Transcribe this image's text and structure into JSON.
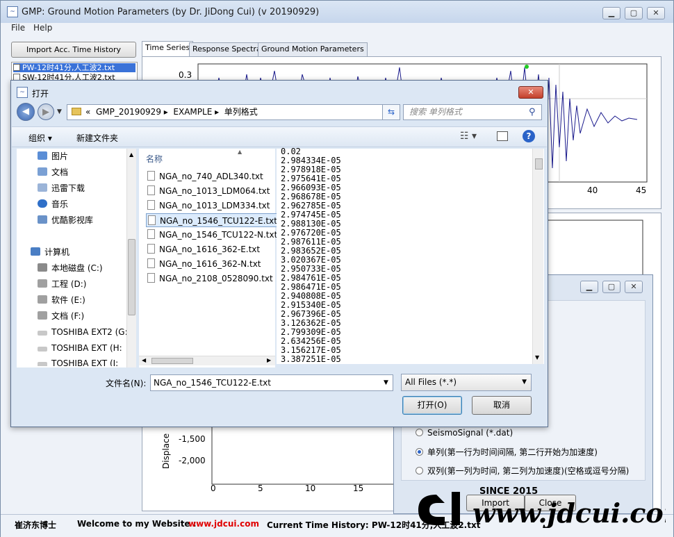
{
  "main": {
    "title": "GMP: Ground Motion Parameters (by Dr. JiDong Cui) (v 20190929)",
    "menu": [
      "File",
      "Help"
    ],
    "import_button": "Import Acc. Time History",
    "files": [
      "PW-12时41分,人工波2.txt",
      "SW-12时41分,人工波2.txt"
    ],
    "tabs": [
      "Time Series",
      "Response Spectra",
      "Ground Motion Parameters"
    ],
    "plot_top": {
      "ytick": "0.3",
      "xticks": [
        "40",
        "45"
      ]
    },
    "plot_bottom": {
      "ylabel": "Displace",
      "yticks": [
        "-1,500",
        "-2,000"
      ],
      "xticks": [
        "0",
        "5",
        "10",
        "15"
      ]
    }
  },
  "status": {
    "author": "崔济东博士",
    "welcome": "Welcome to my Website :",
    "url": "www.jdcui.com",
    "current": "Current Time History: PW-12时41分,人工波2.txt"
  },
  "dialog": {
    "title": "打开",
    "breadcrumb": [
      "GMP_20190929",
      "EXAMPLE",
      "单列格式"
    ],
    "search_placeholder": "搜索 单列格式",
    "toolbar": {
      "organize": "组织 ▾",
      "new_folder": "新建文件夹"
    },
    "nav_items": [
      "图片",
      "文档",
      "迅雷下载",
      "音乐",
      "优酷影视库",
      "计算机",
      "本地磁盘 (C:)",
      "工程 (D:)",
      "软件 (E:)",
      "文档 (F:)",
      "TOSHIBA EXT2 (G:",
      "TOSHIBA EXT (H:",
      "TOSHIBA EXT (I:"
    ],
    "column_header": "名称",
    "files": [
      "NGA_no_740_ADL340.txt",
      "NGA_no_1013_LDM064.txt",
      "NGA_no_1013_LDM334.txt",
      "NGA_no_1546_TCU122-E.txt",
      "NGA_no_1546_TCU122-N.txt",
      "NGA_no_1616_362-E.txt",
      "NGA_no_1616_362-N.txt",
      "NGA_no_2108_0528090.txt"
    ],
    "selected_index": 3,
    "preview_lines": [
      "0.02",
      "2.984334E-05",
      "2.978918E-05",
      "2.975641E-05",
      "2.966093E-05",
      "2.968678E-05",
      "2.962785E-05",
      "2.974745E-05",
      "2.988130E-05",
      "2.976720E-05",
      "2.987611E-05",
      "2.983652E-05",
      "3.020367E-05",
      "2.950733E-05",
      "2.984761E-05",
      "2.986471E-05",
      "2.940808E-05",
      "2.915340E-05",
      "2.967396E-05",
      "3.126362E-05",
      "2.799309E-05",
      "2.634256E-05",
      "3.156217E-05",
      "3.387251E-05"
    ],
    "filename_label": "文件名(N):",
    "filename_value": "NGA_no_1546_TCU122-E.txt",
    "filetype": "All Files (*.*)",
    "open_button": "打开(O)",
    "cancel_button": "取消"
  },
  "import_window": {
    "options": [
      "SeismoSignal (*.dat)",
      "单列(第一行为时间间隔, 第二行开始为加速度)",
      "双列(第一列为时间, 第二列为加速度)(空格或逗号分隔)"
    ],
    "selected_option": 1,
    "import_button": "Import",
    "close_button": "Close"
  },
  "watermark": {
    "since": "SINCE 2015",
    "text": "www.jdcui.com"
  }
}
